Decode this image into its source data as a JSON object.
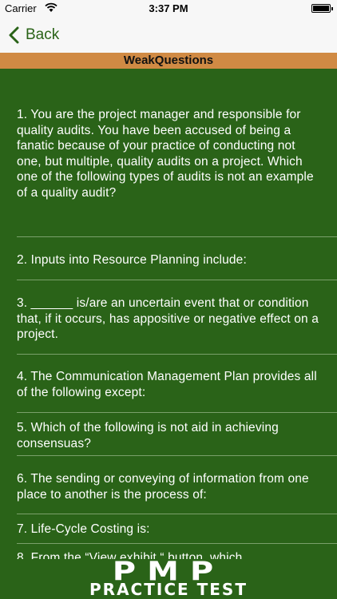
{
  "status_bar": {
    "carrier": "Carrier",
    "time": "3:37 PM"
  },
  "nav": {
    "back_label": "Back"
  },
  "header": {
    "title": "WeakQuestions"
  },
  "questions": [
    "1. You are the project manager and responsible for quality audits. You have been accused of being a fanatic because of your practice of conducting not one, but multiple, quality audits on a project. Which one of the following types of audits is not an example of a quality audit?",
    "2. Inputs into Resource Planning include:",
    "3. ______ is/are an uncertain event that or condition that, if it occurs, has appositive or negative effect on a project.",
    "4. The Communication Management Plan provides all of the following except:",
    "5. Which of the following is not aid  in achieving consensuas?",
    "6. The sending or conveying of information from one place to another is the process of:",
    "7. Life-Cycle Costing is:",
    "8. From the “View exhibit “ button, which"
  ],
  "banner": {
    "logo_text": "PMP",
    "subtitle": "PRACTICE TEST"
  },
  "colors": {
    "background": "#2a6318",
    "title_bar": "#d08a44",
    "accent": "#2a6318"
  }
}
